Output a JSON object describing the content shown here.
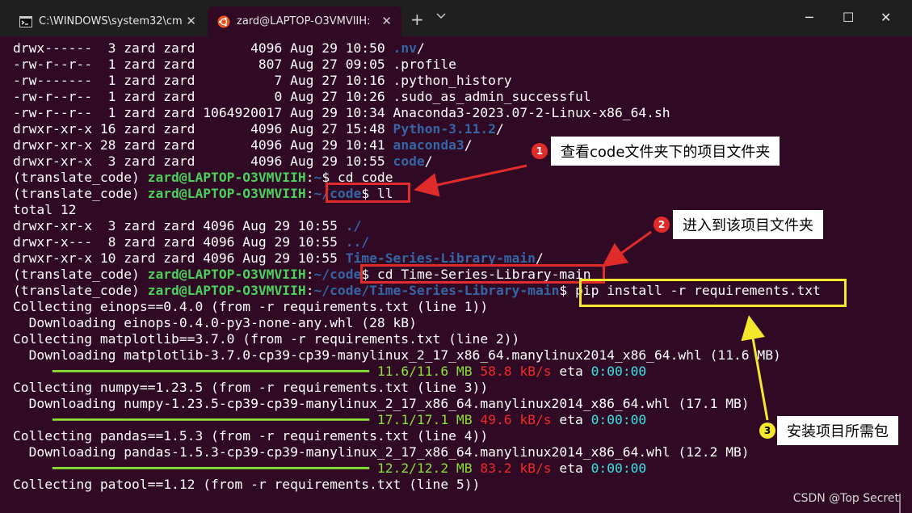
{
  "tabs": [
    {
      "title": "C:\\WINDOWS\\system32\\cm",
      "icon": "cmd-icon"
    },
    {
      "title": "zard@LAPTOP-O3VMVIIH:",
      "icon": "ubuntu-icon"
    }
  ],
  "window_controls": {
    "new_tab": "+",
    "minimize": "─",
    "maximize": "☐",
    "close": "✕"
  },
  "colors": {
    "terminal_bg": "#300a24",
    "prompt_user": "#4ad15a",
    "prompt_path": "#3465a4",
    "progress_bar": "#8ae234",
    "speed": "#ef2929",
    "eta": "#34e2e2",
    "annotation_red": "#e02b2b",
    "annotation_yellow": "#f4e82c"
  },
  "terminal": {
    "lines": [
      {
        "segs": [
          {
            "t": "drwx------  3 zard zard       4096 Aug 29 10:50 ",
            "c": "w"
          },
          {
            "t": ".nv",
            "c": "b"
          },
          {
            "t": "/",
            "c": "w"
          }
        ]
      },
      {
        "segs": [
          {
            "t": "-rw-r--r--  1 zard zard        807 Aug 27 09:05 .profile",
            "c": "w"
          }
        ]
      },
      {
        "segs": [
          {
            "t": "-rw-------  1 zard zard          7 Aug 27 10:16 .python_history",
            "c": "w"
          }
        ]
      },
      {
        "segs": [
          {
            "t": "-rw-r--r--  1 zard zard          0 Aug 27 10:26 .sudo_as_admin_successful",
            "c": "w"
          }
        ]
      },
      {
        "segs": [
          {
            "t": "-rw-r--r--  1 zard zard 1064920017 Aug 29 10:34 Anaconda3-2023.07-2-Linux-x86_64.sh",
            "c": "w"
          }
        ]
      },
      {
        "segs": [
          {
            "t": "drwxr-xr-x 16 zard zard       4096 Aug 27 15:48 ",
            "c": "w"
          },
          {
            "t": "Python-3.11.2",
            "c": "b"
          },
          {
            "t": "/",
            "c": "w"
          }
        ]
      },
      {
        "segs": [
          {
            "t": "drwxr-xr-x 28 zard zard       4096 Aug 29 10:41 ",
            "c": "w"
          },
          {
            "t": "anaconda3",
            "c": "b"
          },
          {
            "t": "/",
            "c": "w"
          }
        ]
      },
      {
        "segs": [
          {
            "t": "drwxr-xr-x  3 zard zard       4096 Aug 29 10:55 ",
            "c": "w"
          },
          {
            "t": "code",
            "c": "b"
          },
          {
            "t": "/",
            "c": "w"
          }
        ]
      },
      {
        "segs": [
          {
            "t": "(translate_code) ",
            "c": "w"
          },
          {
            "t": "zard@LAPTOP-O3VMVIIH",
            "c": "g"
          },
          {
            "t": ":",
            "c": "w"
          },
          {
            "t": "~",
            "c": "b"
          },
          {
            "t": "$ cd code",
            "c": "w"
          }
        ]
      },
      {
        "segs": [
          {
            "t": "(translate_code) ",
            "c": "w"
          },
          {
            "t": "zard@LAPTOP-O3VMVIIH",
            "c": "g"
          },
          {
            "t": ":",
            "c": "w"
          },
          {
            "t": "~/code",
            "c": "b"
          },
          {
            "t": "$ ll",
            "c": "w"
          }
        ]
      },
      {
        "segs": [
          {
            "t": "total 12",
            "c": "w"
          }
        ]
      },
      {
        "segs": [
          {
            "t": "drwxr-xr-x  3 zard zard 4096 Aug 29 10:55 ",
            "c": "w"
          },
          {
            "t": "./",
            "c": "b"
          }
        ]
      },
      {
        "segs": [
          {
            "t": "drwxr-x---  8 zard zard 4096 Aug 29 10:55 ",
            "c": "w"
          },
          {
            "t": "../",
            "c": "b"
          }
        ]
      },
      {
        "segs": [
          {
            "t": "drwxr-xr-x 10 zard zard 4096 Aug 29 10:55 ",
            "c": "w"
          },
          {
            "t": "Time-Series-Library-main",
            "c": "b"
          },
          {
            "t": "/",
            "c": "w"
          }
        ]
      },
      {
        "segs": [
          {
            "t": "(translate_code) ",
            "c": "w"
          },
          {
            "t": "zard@LAPTOP-O3VMVIIH",
            "c": "g"
          },
          {
            "t": ":",
            "c": "w"
          },
          {
            "t": "~/code",
            "c": "b"
          },
          {
            "t": "$ cd Time-Series-Library-main",
            "c": "w"
          }
        ]
      },
      {
        "segs": [
          {
            "t": "(translate_code) ",
            "c": "w"
          },
          {
            "t": "zard@LAPTOP-O3VMVIIH",
            "c": "g"
          },
          {
            "t": ":",
            "c": "w"
          },
          {
            "t": "~/code/Time-Series-Library-main",
            "c": "b"
          },
          {
            "t": "$ pip install -r requirements.txt",
            "c": "w"
          }
        ]
      },
      {
        "segs": [
          {
            "t": "Collecting einops==0.4.0 (from -r requirements.txt (line 1))",
            "c": "w"
          }
        ]
      },
      {
        "segs": [
          {
            "t": "  Downloading einops-0.4.0-py3-none-any.whl (28 kB)",
            "c": "w"
          }
        ]
      },
      {
        "segs": [
          {
            "t": "Collecting matplotlib==3.7.0 (from -r requirements.txt (line 2))",
            "c": "w"
          }
        ]
      },
      {
        "segs": [
          {
            "t": "  Downloading matplotlib-3.7.0-cp39-cp39-manylinux_2_17_x86_64.manylinux2014_x86_64.whl (11.6 MB)",
            "c": "w"
          }
        ]
      },
      {
        "segs": [
          {
            "t": "     ━━━━━━━━━━━━━━━━━━━━━━━━━━━━━━━━━━━━━━━━ ",
            "c": "lg"
          },
          {
            "t": "11.6/11.6 MB",
            "c": "lg"
          },
          {
            "t": " ",
            "c": "w"
          },
          {
            "t": "58.8 kB/s",
            "c": "r"
          },
          {
            "t": " eta ",
            "c": "w"
          },
          {
            "t": "0:00:00",
            "c": "c"
          }
        ]
      },
      {
        "segs": [
          {
            "t": "Collecting numpy==1.23.5 (from -r requirements.txt (line 3))",
            "c": "w"
          }
        ]
      },
      {
        "segs": [
          {
            "t": "  Downloading numpy-1.23.5-cp39-cp39-manylinux_2_17_x86_64.manylinux2014_x86_64.whl (17.1 MB)",
            "c": "w"
          }
        ]
      },
      {
        "segs": [
          {
            "t": "     ━━━━━━━━━━━━━━━━━━━━━━━━━━━━━━━━━━━━━━━━ ",
            "c": "lg"
          },
          {
            "t": "17.1/17.1 MB",
            "c": "lg"
          },
          {
            "t": " ",
            "c": "w"
          },
          {
            "t": "49.6 kB/s",
            "c": "r"
          },
          {
            "t": " eta ",
            "c": "w"
          },
          {
            "t": "0:00:00",
            "c": "c"
          }
        ]
      },
      {
        "segs": [
          {
            "t": "Collecting pandas==1.5.3 (from -r requirements.txt (line 4))",
            "c": "w"
          }
        ]
      },
      {
        "segs": [
          {
            "t": "  Downloading pandas-1.5.3-cp39-cp39-manylinux_2_17_x86_64.manylinux2014_x86_64.whl (12.2 MB)",
            "c": "w"
          }
        ]
      },
      {
        "segs": [
          {
            "t": "     ━━━━━━━━━━━━━━━━━━━━━━━━━━━━━━━━━━━━━━━━ ",
            "c": "lg"
          },
          {
            "t": "12.2/12.2 MB",
            "c": "lg"
          },
          {
            "t": " ",
            "c": "w"
          },
          {
            "t": "83.2 kB/s",
            "c": "r"
          },
          {
            "t": " eta ",
            "c": "w"
          },
          {
            "t": "0:00:00",
            "c": "c"
          }
        ]
      },
      {
        "segs": [
          {
            "t": "Collecting patool==1.12 (from -r requirements.txt (line 5))",
            "c": "w"
          }
        ]
      }
    ]
  },
  "annotations": [
    {
      "number": "1",
      "text": "查看code文件夹下的项目文件夹"
    },
    {
      "number": "2",
      "text": "进入到该项目文件夹"
    },
    {
      "number": "3",
      "text": "安装项目所需包"
    }
  ],
  "watermark": "CSDN @Top Secret"
}
